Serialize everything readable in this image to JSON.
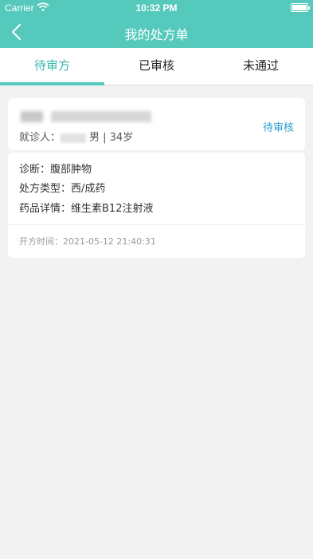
{
  "status_bar": {
    "carrier": "Carrier",
    "time": "10:32 PM"
  },
  "header": {
    "title": "我的处方单",
    "back_icon": "chevron-left-icon"
  },
  "tabs": [
    {
      "label": "待审方",
      "active": true
    },
    {
      "label": "已审核",
      "active": false
    },
    {
      "label": "未通过",
      "active": false
    }
  ],
  "prescription": {
    "patient_label": "就诊人：",
    "patient_info": "男 | 34岁",
    "status": "待审核",
    "diagnosis": "诊断：腹部肿物",
    "type": "处方类型：西/成药",
    "drugs": "药品详情：维生素B12注射液",
    "opened_time": "开方时间：2021-05-12 21:40:31"
  },
  "colors": {
    "accent": "#56c9bd",
    "status": "#2a9ecf"
  }
}
